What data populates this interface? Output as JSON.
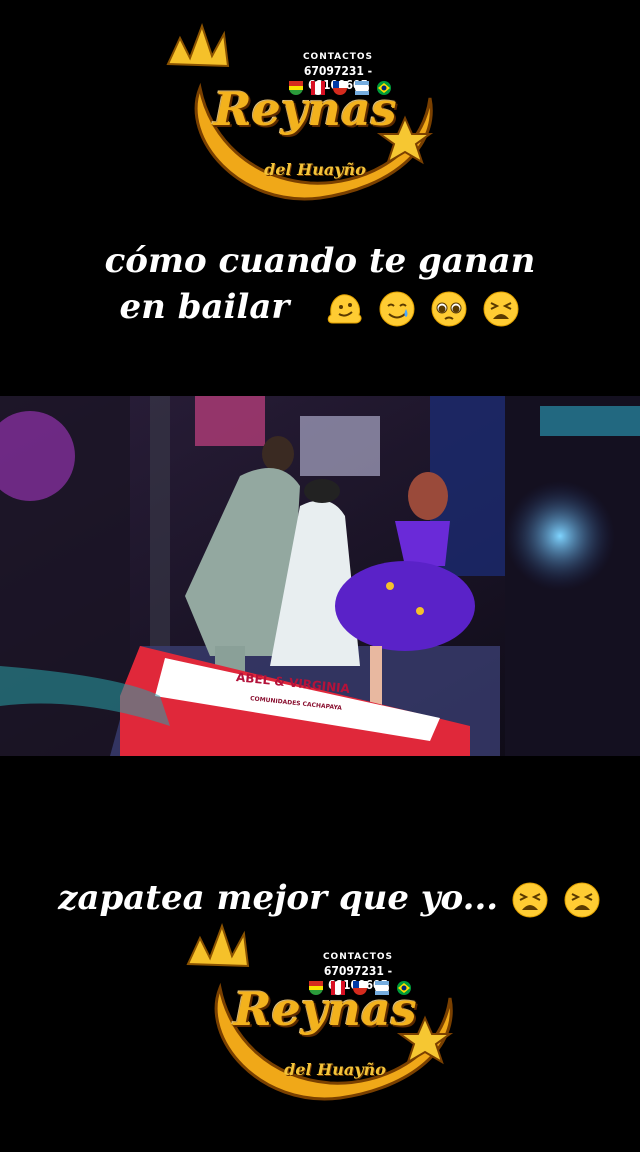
{
  "logo": {
    "contact_label": "CONTACTOS",
    "phones": "67097231 - 68100605",
    "brand": "Reynas",
    "sub": "del Huayño",
    "flags": [
      "bolivia-flag",
      "peru-flag",
      "chile-flag",
      "argentina-flag",
      "brazil-flag"
    ]
  },
  "caption_top": {
    "line1": "cómo cuando te ganan",
    "line2": "en bailar",
    "emojis": [
      "melting-face-emoji",
      "smiling-face-with-tear-emoji",
      "pleading-face-emoji",
      "tired-face-emoji"
    ]
  },
  "video": {
    "banner_name": "ABEL & VIRGINIA",
    "banner_sub": "COMUNIDADES CACHAPAYA"
  },
  "caption_bottom": {
    "text": "zapatea mejor que yo...",
    "emojis": [
      "tired-face-emoji",
      "tired-face-emoji"
    ]
  },
  "colors": {
    "gold": "#f3b21d",
    "background": "#000000",
    "skirt": "#5a22c8",
    "banner_red": "#e0283a"
  }
}
